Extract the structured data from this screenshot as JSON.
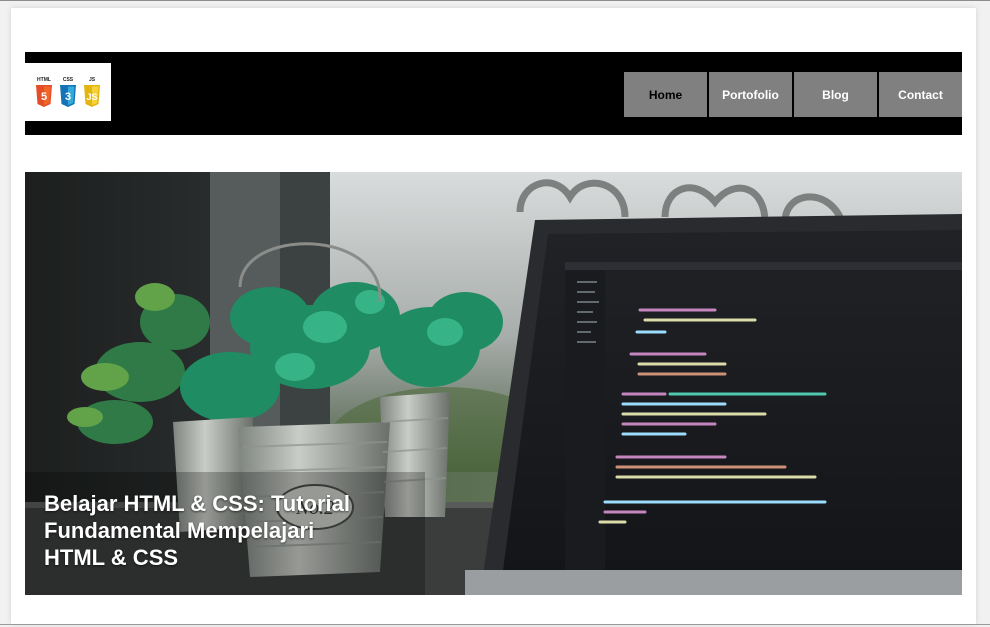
{
  "header": {
    "logo": {
      "badges": [
        {
          "label": "HTML",
          "glyph": "5",
          "color": "#e44d26"
        },
        {
          "label": "CSS",
          "glyph": "3",
          "color": "#2965f1"
        },
        {
          "label": "JS",
          "glyph": "JS",
          "color": "#f0c419"
        }
      ]
    },
    "nav": [
      {
        "label": "Home",
        "active": true
      },
      {
        "label": "Portofolio",
        "active": false
      },
      {
        "label": "Blog",
        "active": false
      },
      {
        "label": "Contact",
        "active": false
      }
    ]
  },
  "hero": {
    "title": "Belajar HTML & CSS: Tutorial Fundamental Mempelajari HTML & CSS",
    "image_subject": "laptop-with-code-and-potted-plants"
  },
  "colors": {
    "navbar_bg": "#000000",
    "nav_item_bg": "#808080",
    "nav_active_text": "#000000",
    "nav_text": "#ffffff"
  }
}
